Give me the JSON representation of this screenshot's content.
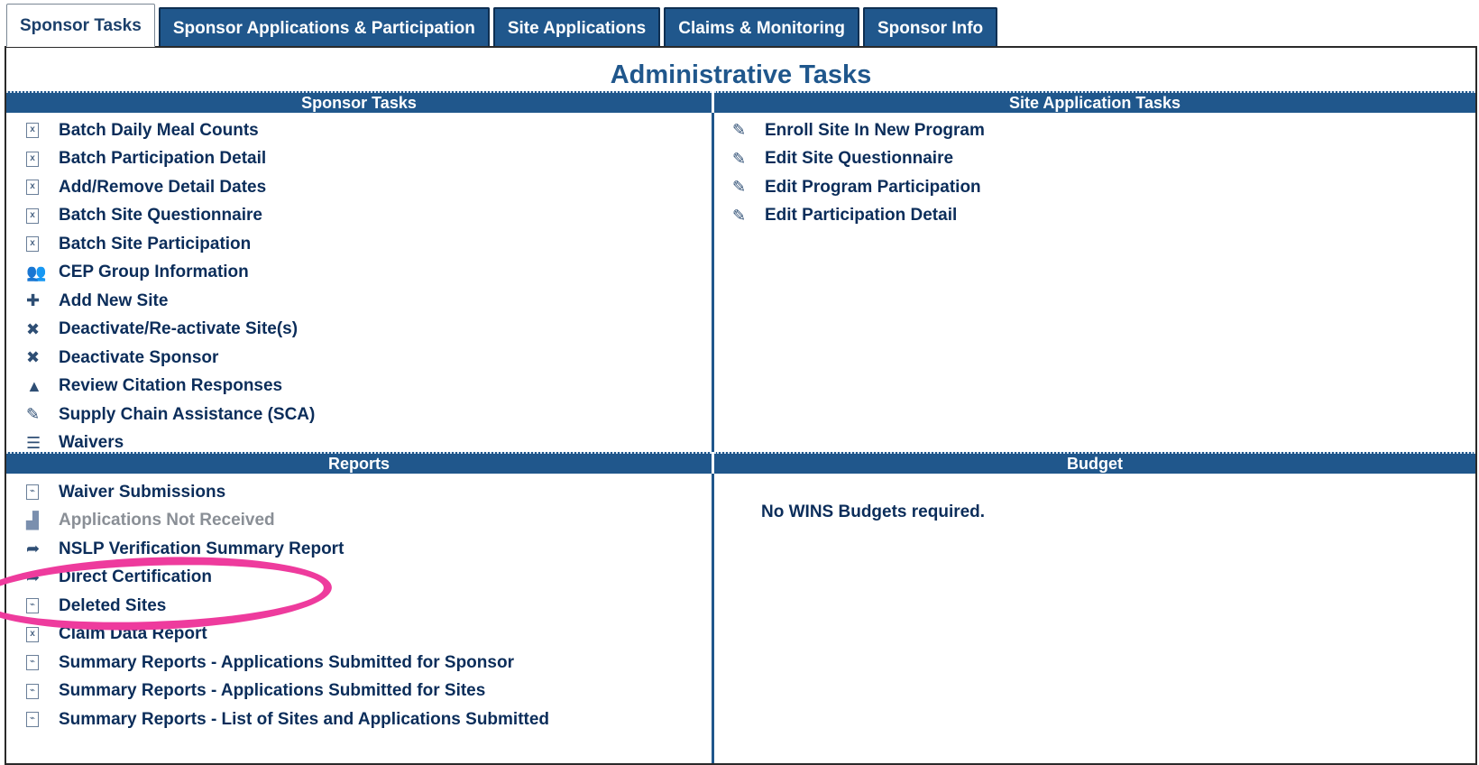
{
  "tabs": [
    {
      "label": "Sponsor Tasks",
      "active": true
    },
    {
      "label": "Sponsor Applications & Participation",
      "active": false
    },
    {
      "label": "Site Applications",
      "active": false
    },
    {
      "label": "Claims & Monitoring",
      "active": false
    },
    {
      "label": "Sponsor Info",
      "active": false
    }
  ],
  "page_title": "Administrative Tasks",
  "sponsor_tasks": {
    "header": "Sponsor Tasks",
    "items": [
      {
        "label": "Batch Daily Meal Counts",
        "icon": "excel-file-icon"
      },
      {
        "label": "Batch Participation Detail",
        "icon": "excel-file-icon"
      },
      {
        "label": "Add/Remove Detail Dates",
        "icon": "excel-file-icon"
      },
      {
        "label": "Batch Site Questionnaire",
        "icon": "excel-file-icon"
      },
      {
        "label": "Batch Site Participation",
        "icon": "excel-file-icon"
      },
      {
        "label": "CEP Group Information",
        "icon": "group-icon"
      },
      {
        "label": "Add New Site",
        "icon": "plus-icon"
      },
      {
        "label": "Deactivate/Re-activate Site(s)",
        "icon": "x-icon"
      },
      {
        "label": "Deactivate Sponsor",
        "icon": "x-icon"
      },
      {
        "label": "Review Citation Responses",
        "icon": "warning-icon"
      },
      {
        "label": "Supply Chain Assistance (SCA)",
        "icon": "edit-icon"
      },
      {
        "label": "Waivers",
        "icon": "list-icon"
      }
    ]
  },
  "site_application_tasks": {
    "header": "Site Application Tasks",
    "items": [
      {
        "label": "Enroll Site In New Program",
        "icon": "edit-icon"
      },
      {
        "label": "Edit Site Questionnaire",
        "icon": "edit-icon"
      },
      {
        "label": "Edit Program Participation",
        "icon": "edit-icon"
      },
      {
        "label": "Edit Participation Detail",
        "icon": "edit-icon"
      }
    ]
  },
  "reports": {
    "header": "Reports",
    "items": [
      {
        "label": "Waiver Submissions",
        "icon": "pdf-file-icon",
        "disabled": false
      },
      {
        "label": "Applications Not Received",
        "icon": "bar-chart-icon",
        "disabled": true
      },
      {
        "label": "NSLP Verification Summary Report",
        "icon": "share-arrow-icon",
        "disabled": false
      },
      {
        "label": "Direct Certification",
        "icon": "share-arrow-icon",
        "disabled": false
      },
      {
        "label": "Deleted Sites",
        "icon": "pdf-file-icon",
        "disabled": false
      },
      {
        "label": "Claim Data Report",
        "icon": "excel-file-icon",
        "disabled": false
      },
      {
        "label": "Summary Reports - Applications Submitted for Sponsor",
        "icon": "pdf-file-icon",
        "disabled": false
      },
      {
        "label": "Summary Reports - Applications Submitted for Sites",
        "icon": "pdf-file-icon",
        "disabled": false
      },
      {
        "label": "Summary Reports - List of Sites and Applications Submitted",
        "icon": "pdf-file-icon",
        "disabled": false
      }
    ]
  },
  "budget": {
    "header": "Budget",
    "text": "No WINS Budgets required."
  },
  "annotation": {
    "color": "#ee3b9d",
    "target": "Direct Certification"
  }
}
